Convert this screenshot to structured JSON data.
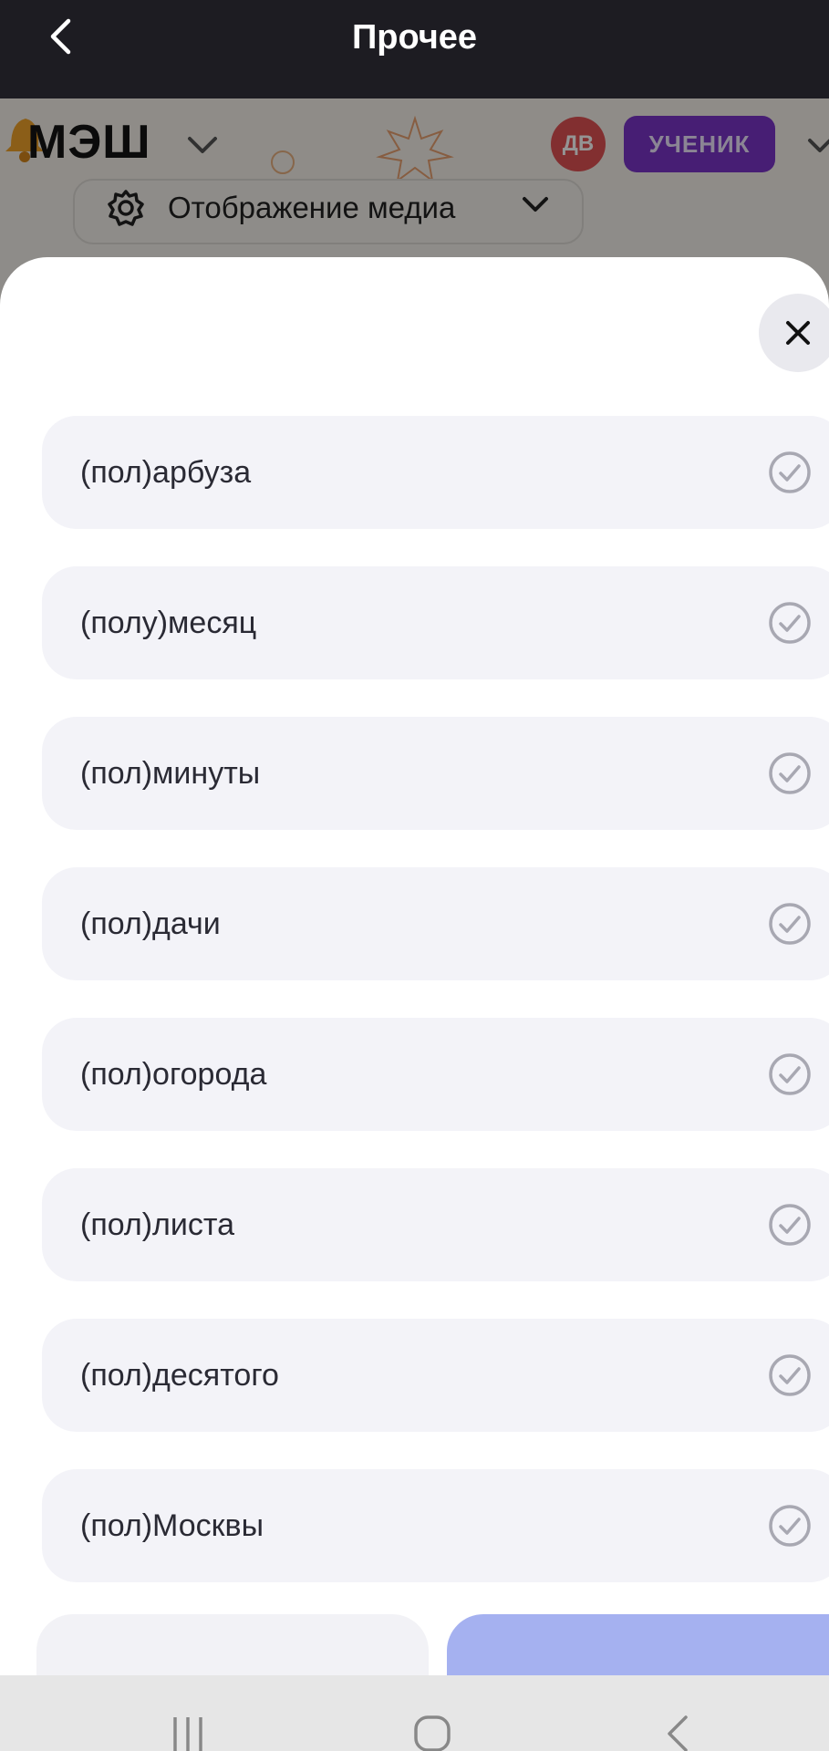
{
  "topbar": {
    "title": "Прочее",
    "back_icon": "chevron-left-icon"
  },
  "app_header": {
    "logo_text": "МЭШ",
    "avatar_initials": "ДВ",
    "role_label": "УЧЕНИК",
    "colors": {
      "avatar": "#e05254",
      "role_button": "#7a34c8"
    }
  },
  "media_dropdown": {
    "label": "Отображение медиа"
  },
  "sheet": {
    "close_icon": "close-icon",
    "options": [
      {
        "label": "(пол)арбуза"
      },
      {
        "label": "(полу)месяц"
      },
      {
        "label": "(пол)минуты"
      },
      {
        "label": "(пол)дачи"
      },
      {
        "label": "(пол)огорода"
      },
      {
        "label": "(пол)листа"
      },
      {
        "label": "(пол)десятого"
      },
      {
        "label": "(пол)Москвы"
      }
    ],
    "check_icon": "check-circle-icon",
    "colors": {
      "option_bg": "#f3f3f8",
      "primary_button": "#a5b1f0"
    }
  },
  "system_nav": {
    "icons": [
      "recent-apps-icon",
      "home-icon",
      "back-icon"
    ]
  }
}
